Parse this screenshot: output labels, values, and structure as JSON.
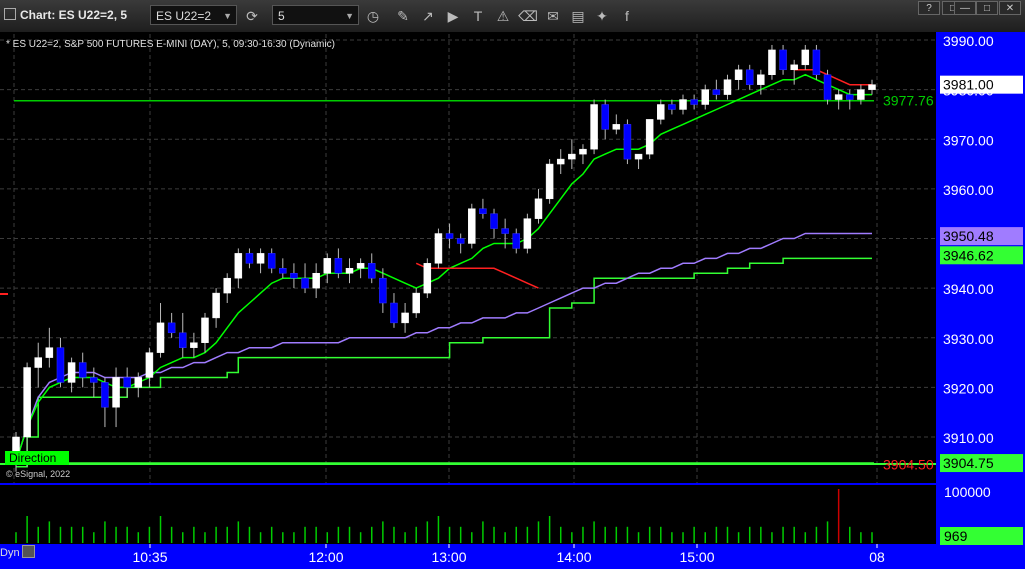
{
  "toolbar": {
    "title": "Chart: ES U22=2, 5",
    "symbol_value": "ES U22=2",
    "interval_value": "5",
    "icons": [
      "refresh-icon",
      "clock-icon",
      "pencil-icon",
      "trend-icon",
      "play-icon",
      "text-icon",
      "alert-icon",
      "eraser-icon",
      "chat-icon",
      "twitter-icon",
      "facebook-icon"
    ],
    "window_buttons": [
      "?",
      "□",
      "—",
      "□",
      "✕"
    ]
  },
  "chart_header": "* ES U22=2, S&P 500 FUTURES E-MINI (DAY), 5, 09:30-16:30 (Dynamic)",
  "copyright": "© eSignal, 2022",
  "direction_label": "Direction",
  "dyn_label": "Dyn",
  "colors": {
    "background": "#000000",
    "grid": "#3c3c3c",
    "axis_panel": "#0000ff",
    "up_candle": "#ffffff",
    "down_candle": "#0000ff",
    "fast_ma": "#00ff00",
    "stepped_line": "#33ff33",
    "vwap": "#a07cff",
    "red_ma": "#ff2020",
    "volume_up": "#00cc00",
    "volume_down": "#cc0000"
  },
  "chart_data": {
    "type": "candlestick",
    "y_axis_ticks": [
      "3990.00",
      "3980.00",
      "3970.00",
      "3960.00",
      "3950.00",
      "3940.00",
      "3930.00",
      "3920.00",
      "3910.00"
    ],
    "x_axis_ticks": [
      "10:35",
      "12:00",
      "13:00",
      "14:00",
      "15:00",
      "08"
    ],
    "ylim": [
      3905,
      3990
    ],
    "price_labels": [
      {
        "text": "3981.00",
        "value": 3981.0,
        "bg": "#ffffff",
        "fg": "#000000"
      },
      {
        "text": "3977.76",
        "value": 3977.76,
        "bg": "none",
        "fg": "#00cc00"
      },
      {
        "text": "3950.48",
        "value": 3950.48,
        "bg": "#a07cff",
        "fg": "#000000"
      },
      {
        "text": "3946.62",
        "value": 3946.62,
        "bg": "#33ff33",
        "fg": "#000000"
      },
      {
        "text": "3904.50",
        "value": 3904.5,
        "bg": "none",
        "fg": "#ff2020"
      },
      {
        "text": "3904.75",
        "value": 3904.75,
        "bg": "#33ff33",
        "fg": "#000000"
      }
    ],
    "horizontal_lines": [
      {
        "name": "level-3977",
        "value": 3977.76,
        "color": "#00cc00"
      },
      {
        "name": "level-3904",
        "value": 3904.75,
        "color": "#33ff33"
      }
    ],
    "volume_axis_labels": [
      "100000",
      "969"
    ],
    "candles": [
      {
        "o": 3907,
        "h": 3911,
        "l": 3903,
        "c": 3910
      },
      {
        "o": 3910,
        "h": 3925,
        "l": 3904,
        "c": 3924
      },
      {
        "o": 3924,
        "h": 3929,
        "l": 3920,
        "c": 3926
      },
      {
        "o": 3926,
        "h": 3932,
        "l": 3924,
        "c": 3928
      },
      {
        "o": 3928,
        "h": 3930,
        "l": 3920,
        "c": 3921
      },
      {
        "o": 3921,
        "h": 3926,
        "l": 3919,
        "c": 3925
      },
      {
        "o": 3925,
        "h": 3927,
        "l": 3920,
        "c": 3922
      },
      {
        "o": 3922,
        "h": 3924,
        "l": 3918,
        "c": 3921
      },
      {
        "o": 3921,
        "h": 3922,
        "l": 3912,
        "c": 3916
      },
      {
        "o": 3916,
        "h": 3924,
        "l": 3912,
        "c": 3922
      },
      {
        "o": 3922,
        "h": 3924,
        "l": 3918,
        "c": 3920
      },
      {
        "o": 3920,
        "h": 3923,
        "l": 3918,
        "c": 3922
      },
      {
        "o": 3922,
        "h": 3928,
        "l": 3920,
        "c": 3927
      },
      {
        "o": 3927,
        "h": 3937,
        "l": 3926,
        "c": 3933
      },
      {
        "o": 3933,
        "h": 3935,
        "l": 3930,
        "c": 3931
      },
      {
        "o": 3931,
        "h": 3935,
        "l": 3926,
        "c": 3928
      },
      {
        "o": 3928,
        "h": 3931,
        "l": 3926,
        "c": 3929
      },
      {
        "o": 3929,
        "h": 3935,
        "l": 3927,
        "c": 3934
      },
      {
        "o": 3934,
        "h": 3940,
        "l": 3932,
        "c": 3939
      },
      {
        "o": 3939,
        "h": 3943,
        "l": 3937,
        "c": 3942
      },
      {
        "o": 3942,
        "h": 3948,
        "l": 3940,
        "c": 3947
      },
      {
        "o": 3947,
        "h": 3948,
        "l": 3944,
        "c": 3945
      },
      {
        "o": 3945,
        "h": 3948,
        "l": 3943,
        "c": 3947
      },
      {
        "o": 3947,
        "h": 3948,
        "l": 3943,
        "c": 3944
      },
      {
        "o": 3944,
        "h": 3946,
        "l": 3942,
        "c": 3943
      },
      {
        "o": 3943,
        "h": 3945,
        "l": 3940,
        "c": 3942
      },
      {
        "o": 3942,
        "h": 3945,
        "l": 3939,
        "c": 3940
      },
      {
        "o": 3940,
        "h": 3945,
        "l": 3938,
        "c": 3943
      },
      {
        "o": 3943,
        "h": 3947,
        "l": 3941,
        "c": 3946
      },
      {
        "o": 3946,
        "h": 3948,
        "l": 3942,
        "c": 3943
      },
      {
        "o": 3943,
        "h": 3946,
        "l": 3941,
        "c": 3944
      },
      {
        "o": 3944,
        "h": 3946,
        "l": 3942,
        "c": 3945
      },
      {
        "o": 3945,
        "h": 3947,
        "l": 3941,
        "c": 3942
      },
      {
        "o": 3942,
        "h": 3944,
        "l": 3935,
        "c": 3937
      },
      {
        "o": 3937,
        "h": 3939,
        "l": 3932,
        "c": 3933
      },
      {
        "o": 3933,
        "h": 3937,
        "l": 3931,
        "c": 3935
      },
      {
        "o": 3935,
        "h": 3940,
        "l": 3934,
        "c": 3939
      },
      {
        "o": 3939,
        "h": 3946,
        "l": 3938,
        "c": 3945
      },
      {
        "o": 3945,
        "h": 3952,
        "l": 3944,
        "c": 3951
      },
      {
        "o": 3951,
        "h": 3953,
        "l": 3948,
        "c": 3950
      },
      {
        "o": 3950,
        "h": 3951,
        "l": 3947,
        "c": 3949
      },
      {
        "o": 3949,
        "h": 3957,
        "l": 3948,
        "c": 3956
      },
      {
        "o": 3956,
        "h": 3958,
        "l": 3954,
        "c": 3955
      },
      {
        "o": 3955,
        "h": 3956,
        "l": 3950,
        "c": 3952
      },
      {
        "o": 3952,
        "h": 3954,
        "l": 3948,
        "c": 3951
      },
      {
        "o": 3951,
        "h": 3952,
        "l": 3947,
        "c": 3948
      },
      {
        "o": 3948,
        "h": 3955,
        "l": 3947,
        "c": 3954
      },
      {
        "o": 3954,
        "h": 3960,
        "l": 3953,
        "c": 3958
      },
      {
        "o": 3958,
        "h": 3966,
        "l": 3957,
        "c": 3965
      },
      {
        "o": 3965,
        "h": 3968,
        "l": 3963,
        "c": 3966
      },
      {
        "o": 3966,
        "h": 3970,
        "l": 3964,
        "c": 3967
      },
      {
        "o": 3967,
        "h": 3969,
        "l": 3965,
        "c": 3968
      },
      {
        "o": 3968,
        "h": 3978,
        "l": 3967,
        "c": 3977
      },
      {
        "o": 3977,
        "h": 3978,
        "l": 3970,
        "c": 3972
      },
      {
        "o": 3972,
        "h": 3975,
        "l": 3971,
        "c": 3973
      },
      {
        "o": 3973,
        "h": 3974,
        "l": 3965,
        "c": 3966
      },
      {
        "o": 3966,
        "h": 3967,
        "l": 3964,
        "c": 3967
      },
      {
        "o": 3967,
        "h": 3974,
        "l": 3966,
        "c": 3974
      },
      {
        "o": 3974,
        "h": 3978,
        "l": 3973,
        "c": 3977
      },
      {
        "o": 3977,
        "h": 3978,
        "l": 3975,
        "c": 3976
      },
      {
        "o": 3976,
        "h": 3979,
        "l": 3975,
        "c": 3978
      },
      {
        "o": 3978,
        "h": 3979,
        "l": 3976,
        "c": 3977
      },
      {
        "o": 3977,
        "h": 3981,
        "l": 3976,
        "c": 3980
      },
      {
        "o": 3980,
        "h": 3982,
        "l": 3978,
        "c": 3979
      },
      {
        "o": 3979,
        "h": 3983,
        "l": 3978,
        "c": 3982
      },
      {
        "o": 3982,
        "h": 3985,
        "l": 3980,
        "c": 3984
      },
      {
        "o": 3984,
        "h": 3985,
        "l": 3980,
        "c": 3981
      },
      {
        "o": 3981,
        "h": 3984,
        "l": 3979,
        "c": 3983
      },
      {
        "o": 3983,
        "h": 3989,
        "l": 3982,
        "c": 3988
      },
      {
        "o": 3988,
        "h": 3989,
        "l": 3983,
        "c": 3984
      },
      {
        "o": 3984,
        "h": 3986,
        "l": 3981,
        "c": 3985
      },
      {
        "o": 3985,
        "h": 3989,
        "l": 3984,
        "c": 3988
      },
      {
        "o": 3988,
        "h": 3989,
        "l": 3982,
        "c": 3983
      },
      {
        "o": 3983,
        "h": 3984,
        "l": 3977,
        "c": 3978
      },
      {
        "o": 3978,
        "h": 3980,
        "l": 3976,
        "c": 3979
      },
      {
        "o": 3979,
        "h": 3980,
        "l": 3976,
        "c": 3978
      },
      {
        "o": 3978,
        "h": 3981,
        "l": 3977,
        "c": 3980
      },
      {
        "o": 3980,
        "h": 3982,
        "l": 3979,
        "c": 3981
      }
    ],
    "fast_ma": [
      3905,
      3912,
      3917,
      3920,
      3921,
      3922,
      3922,
      3922,
      3921,
      3920,
      3920,
      3921,
      3922,
      3924,
      3925,
      3926,
      3926,
      3927,
      3929,
      3932,
      3935,
      3937,
      3939,
      3941,
      3942,
      3942,
      3942,
      3942,
      3943,
      3943,
      3943,
      3944,
      3944,
      3943,
      3942,
      3941,
      3940,
      3941,
      3942,
      3944,
      3945,
      3946,
      3948,
      3949,
      3949,
      3949,
      3950,
      3952,
      3955,
      3958,
      3961,
      3963,
      3966,
      3967,
      3968,
      3968,
      3968,
      3969,
      3971,
      3972,
      3973,
      3974,
      3975,
      3976,
      3977,
      3978,
      3979,
      3980,
      3981,
      3982,
      3982,
      3983,
      3982,
      3981,
      3980,
      3979,
      3979,
      3979
    ],
    "red_ma": {
      "start_index": 36,
      "values": [
        3945,
        3944,
        3944,
        3944,
        3944,
        3944,
        3944,
        3944,
        3943,
        3942,
        3941,
        3940
      ]
    },
    "red_ma_tail": {
      "start_index": 70,
      "values": [
        3984,
        3984,
        3984,
        3983,
        3982,
        3981,
        3981,
        3981
      ]
    },
    "stepped_line": [
      3904,
      3910,
      3918,
      3918,
      3918,
      3918,
      3918,
      3918,
      3918,
      3918,
      3920,
      3920,
      3920,
      3922,
      3922,
      3922,
      3922,
      3922,
      3922,
      3923,
      3926,
      3926,
      3926,
      3926,
      3926,
      3926,
      3926,
      3926,
      3926,
      3926,
      3926,
      3926,
      3926,
      3926,
      3926,
      3926,
      3926,
      3926,
      3926,
      3929,
      3929,
      3929,
      3930,
      3930,
      3930,
      3930,
      3930,
      3930,
      3936,
      3936,
      3937,
      3937,
      3942,
      3942,
      3942,
      3942,
      3942,
      3942,
      3942,
      3942,
      3942,
      3943,
      3943,
      3943,
      3944,
      3944,
      3945,
      3945,
      3945,
      3946,
      3946,
      3946,
      3946,
      3946,
      3946,
      3946,
      3946,
      3946
    ],
    "vwap": [
      3905,
      3912,
      3918,
      3921,
      3922,
      3923,
      3923,
      3923,
      3922,
      3922,
      3922,
      3922,
      3923,
      3923,
      3924,
      3924,
      3925,
      3925,
      3926,
      3927,
      3927,
      3928,
      3928,
      3928,
      3929,
      3929,
      3929,
      3929,
      3929,
      3929,
      3930,
      3930,
      3930,
      3930,
      3930,
      3930,
      3931,
      3931,
      3932,
      3932,
      3933,
      3933,
      3934,
      3934,
      3934,
      3935,
      3935,
      3936,
      3937,
      3938,
      3939,
      3940,
      3940,
      3941,
      3941,
      3942,
      3943,
      3943,
      3944,
      3944,
      3945,
      3945,
      3946,
      3946,
      3947,
      3947,
      3948,
      3948,
      3949,
      3950,
      3950,
      3951,
      3951,
      3951,
      3951,
      3951,
      3951,
      3951
    ],
    "volume": [
      2,
      5,
      3,
      4,
      3,
      3,
      3,
      2,
      4,
      3,
      3,
      2,
      3,
      5,
      3,
      2,
      3,
      2,
      3,
      3,
      4,
      3,
      2,
      3,
      2,
      2,
      3,
      3,
      2,
      3,
      3,
      2,
      3,
      4,
      3,
      2,
      3,
      4,
      5,
      3,
      3,
      2,
      4,
      3,
      2,
      3,
      3,
      4,
      5,
      3,
      2,
      3,
      4,
      3,
      3,
      3,
      2,
      3,
      3,
      2,
      2,
      3,
      2,
      3,
      3,
      2,
      3,
      3,
      2,
      3,
      3,
      2,
      3,
      4,
      10,
      3,
      2,
      2
    ]
  }
}
